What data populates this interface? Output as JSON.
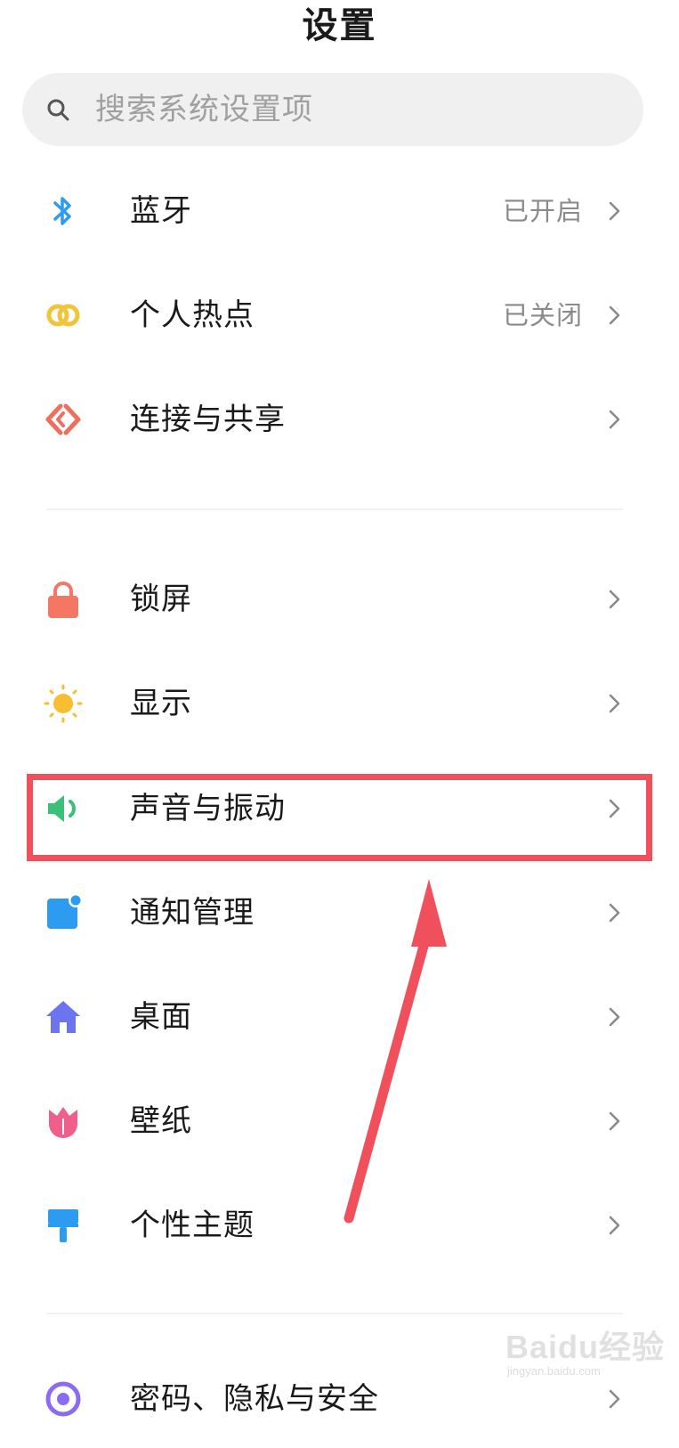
{
  "header": {
    "title": "设置"
  },
  "search": {
    "placeholder": "搜索系统设置项"
  },
  "items": [
    {
      "label": "蓝牙",
      "status": "已开启",
      "icon": "bluetooth-icon",
      "color": "#2f9bf0"
    },
    {
      "label": "个人热点",
      "status": "已关闭",
      "icon": "hotspot-icon",
      "color": "#f2c43a"
    },
    {
      "label": "连接与共享",
      "status": "",
      "icon": "connection-sharing-icon",
      "color": "#ef6f5e"
    },
    {
      "label": "锁屏",
      "status": "",
      "icon": "lock-icon",
      "color": "#f57663"
    },
    {
      "label": "显示",
      "status": "",
      "icon": "sun-icon",
      "color": "#f7bf2f"
    },
    {
      "label": "声音与振动",
      "status": "",
      "icon": "speaker-icon",
      "color": "#3bc07a"
    },
    {
      "label": "通知管理",
      "status": "",
      "icon": "notification-icon",
      "color": "#2d9cf0"
    },
    {
      "label": "桌面",
      "status": "",
      "icon": "home-icon",
      "color": "#6c74f0"
    },
    {
      "label": "壁纸",
      "status": "",
      "icon": "tulip-icon",
      "color": "#ef5f8a"
    },
    {
      "label": "个性主题",
      "status": "",
      "icon": "paint-roller-icon",
      "color": "#2d9cf0"
    },
    {
      "label": "密码、隐私与安全",
      "status": "",
      "icon": "privacy-icon",
      "color": "#8b6cf0"
    }
  ],
  "annotation": {
    "highlight_color": "#f0505b"
  },
  "watermark": {
    "text": "Baidu经验",
    "url": "jingyan.baidu.com"
  }
}
